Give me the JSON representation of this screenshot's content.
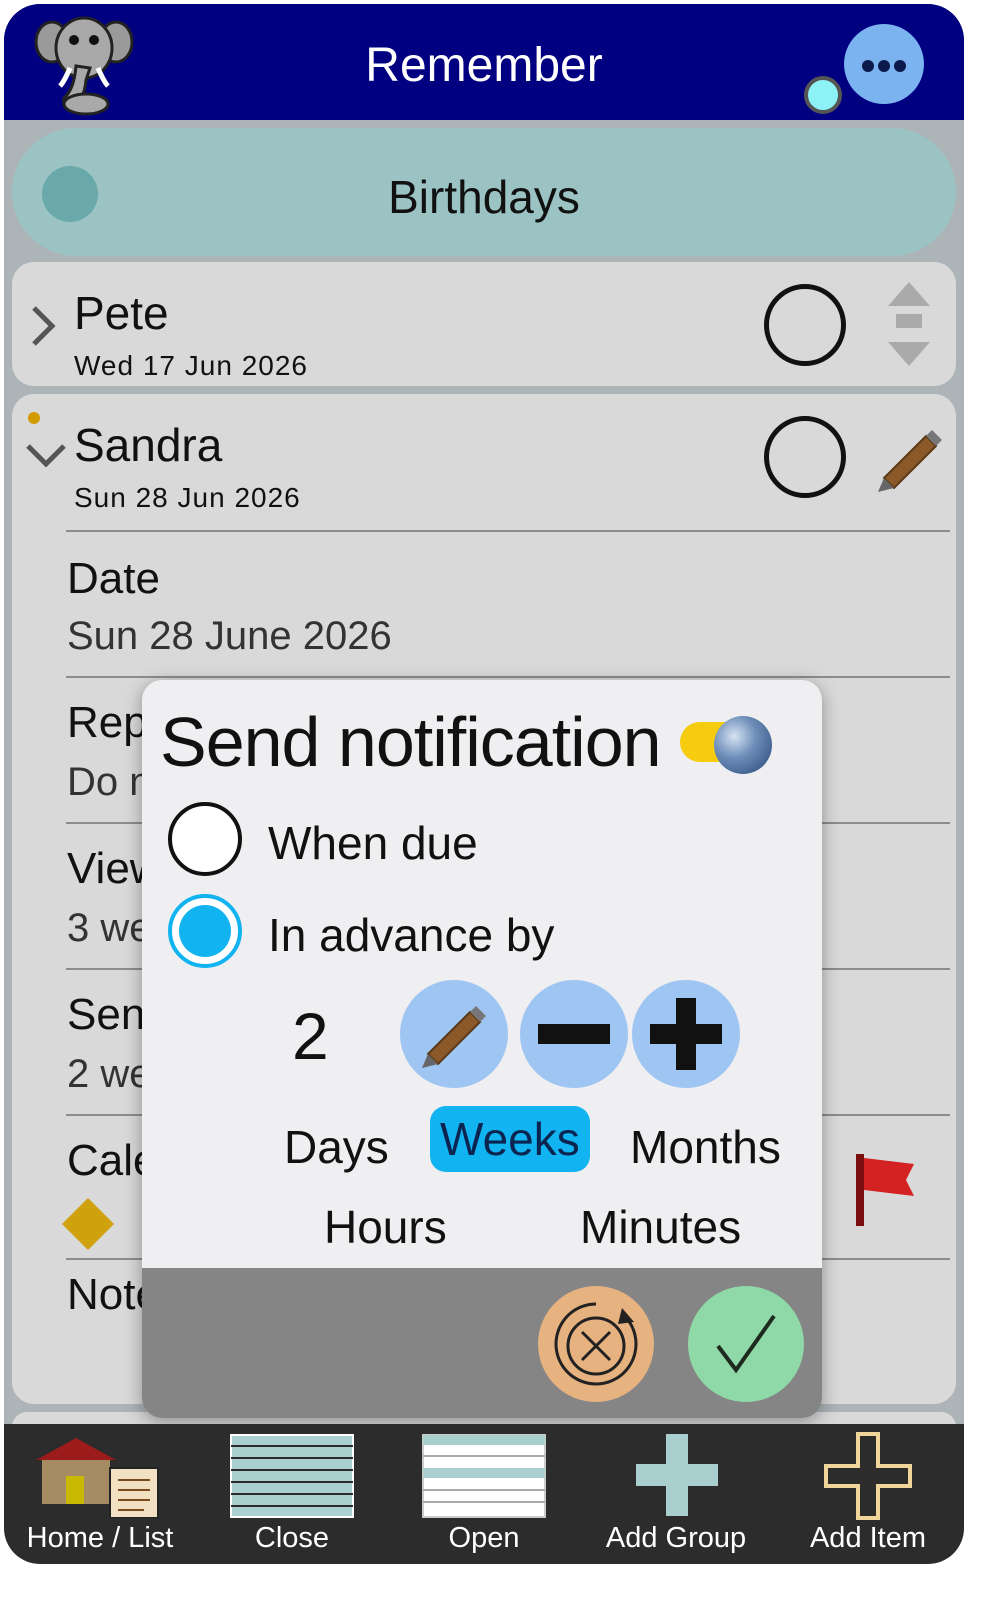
{
  "header": {
    "title": "Remember"
  },
  "group": {
    "title": "Birthdays"
  },
  "items": [
    {
      "name": "Pete",
      "date": "Wed  17  Jun  2026"
    },
    {
      "name": "Sandra",
      "date": "Sun  28  Jun  2026"
    }
  ],
  "details": {
    "date_label": "Date",
    "date_value": "Sun 28 June 2026",
    "repeat_label": "Rep",
    "repeat_value": "Do n",
    "view_label": "View",
    "view_value": "3 we",
    "send_label": "Sen",
    "send_value": "2 we",
    "calendar_label": "Cale",
    "notes_label": "Note"
  },
  "dialog": {
    "title": "Send notification",
    "toggle_on": true,
    "option_when_due": "When due",
    "option_in_advance": "In advance by",
    "selected_option": "In advance by",
    "count": "2",
    "units": {
      "days": "Days",
      "weeks": "Weeks",
      "months": "Months",
      "hours": "Hours",
      "minutes": "Minutes"
    },
    "selected_unit": "Weeks"
  },
  "toolbar": {
    "home_list": "Home  /  List",
    "close": "Close",
    "open": "Open",
    "add_group": "Add Group",
    "add_item": "Add Item"
  },
  "colors": {
    "header": "#000080",
    "group": "#9cc3c3",
    "accent": "#11b3f0",
    "toggle": "#f5cc10",
    "cancel": "#e6b27f",
    "confirm": "#8fd8a8"
  }
}
